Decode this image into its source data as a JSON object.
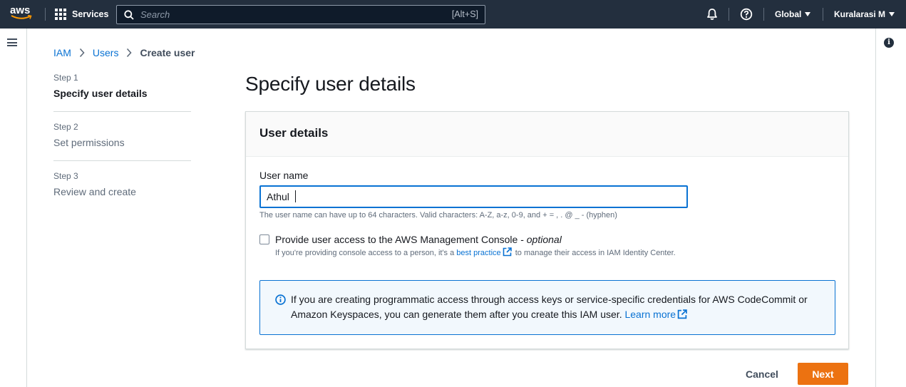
{
  "topnav": {
    "logo_text": "aws",
    "services_label": "Services",
    "search_placeholder": "Search",
    "search_shortcut": "[Alt+S]",
    "region_label": "Global",
    "account_label": "Kuralarasi M"
  },
  "breadcrumb": {
    "items": [
      "IAM",
      "Users"
    ],
    "current": "Create user"
  },
  "steps": [
    {
      "number": "Step 1",
      "title": "Specify user details"
    },
    {
      "number": "Step 2",
      "title": "Set permissions"
    },
    {
      "number": "Step 3",
      "title": "Review and create"
    }
  ],
  "page": {
    "title": "Specify user details"
  },
  "panel": {
    "header": "User details",
    "username_label": "User name",
    "username_value": "Athul",
    "username_hint": "The user name can have up to 64 characters. Valid characters: A-Z, a-z, 0-9, and + = , . @ _ - (hyphen)",
    "console_access_label": "Provide user access to the AWS Management Console - ",
    "console_access_optional": "optional",
    "console_desc_prefix": "If you're providing console access to a person, it's a ",
    "console_desc_link": "best practice",
    "console_desc_suffix": " to manage their access in IAM Identity Center.",
    "alert_text": "If you are creating programmatic access through access keys or service-specific credentials for AWS CodeCommit or Amazon Keyspaces, you can generate them after you create this IAM user. ",
    "alert_link": "Learn more"
  },
  "footer": {
    "cancel_label": "Cancel",
    "next_label": "Next"
  },
  "colors": {
    "nav_bg": "#232f3e",
    "link": "#0972d3",
    "primary_button": "#ec7211",
    "aws_smile": "#ff9900"
  }
}
